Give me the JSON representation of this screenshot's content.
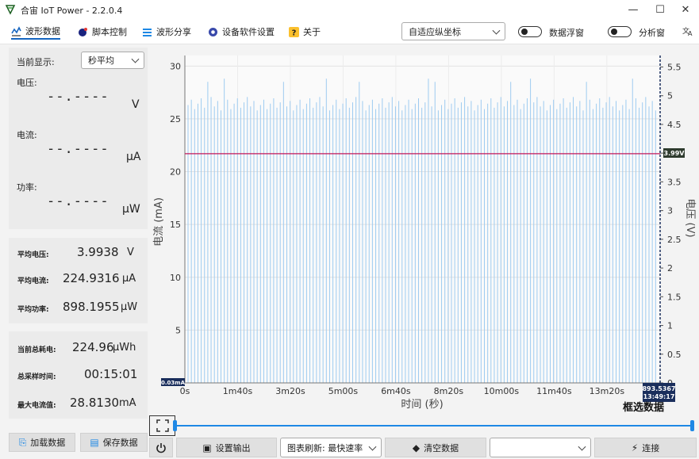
{
  "window": {
    "title": "合宙 IoT Power - 2.2.0.4"
  },
  "tabs": [
    {
      "label": "波形数据",
      "icon": "waveform-icon"
    },
    {
      "label": "脚本控制",
      "icon": "script-icon"
    },
    {
      "label": "波形分享",
      "icon": "share-icon"
    },
    {
      "label": "设备软件设置",
      "icon": "settings-icon"
    },
    {
      "label": "关于",
      "icon": "help-icon"
    }
  ],
  "toolbar": {
    "axis_mode": "自适应纵坐标",
    "float_window_label": "数据浮窗",
    "analysis_window_label": "分析窗"
  },
  "left": {
    "display_label": "当前显示:",
    "display_mode": "秒平均",
    "voltage": {
      "label": "电压:",
      "value": "--.----",
      "unit": "V"
    },
    "current": {
      "label": "电流:",
      "value": "--.----",
      "unit": "μA"
    },
    "power": {
      "label": "功率:",
      "value": "--.----",
      "unit": "μW"
    },
    "avg_voltage": {
      "label": "平均电压:",
      "value": "3.9938",
      "unit": "V"
    },
    "avg_current": {
      "label": "平均电流:",
      "value": "224.9316",
      "unit": "μA"
    },
    "avg_power": {
      "label": "平均功率:",
      "value": "898.1955",
      "unit": "μW"
    },
    "total_energy": {
      "label": "当前总耗电:",
      "value": "224.96",
      "unit": "μWh"
    },
    "sample_time": {
      "label": "总采样时间:",
      "value": "00:15:01"
    },
    "max_current": {
      "label": "最大电流值:",
      "value": "28.8130",
      "unit": "mA"
    },
    "load_button": "加载数据",
    "save_button": "保存数据"
  },
  "chart": {
    "ylabel_left": "电流 (mA)",
    "ylabel_right": "电压 (V)",
    "xlabel": "时间 (秒)",
    "left_ticks": [
      "30",
      "25",
      "20",
      "15",
      "10",
      "5",
      "0"
    ],
    "right_ticks": [
      "5.5",
      "5",
      "4.5",
      "4",
      "3.5",
      "3",
      "2.5",
      "2",
      "1.5",
      "1",
      "0.5",
      "0"
    ],
    "x_ticks": [
      "0s",
      "1m40s",
      "3m20s",
      "5m00s",
      "6m40s",
      "8m20s",
      "10m00s",
      "11m40s",
      "13m20s"
    ],
    "min_label": "0.03mA",
    "voltage_label": "3.99V",
    "cursor_value": "893.5367",
    "cursor_time": "13:49:17",
    "overlay_text": "框选数据"
  },
  "chart_data": {
    "type": "line",
    "xlabel": "时间 (秒)",
    "ylabel": "电流 (mA)",
    "y2label": "电压 (V)",
    "xlim_seconds": [
      0,
      901
    ],
    "ylim": [
      0,
      31
    ],
    "y2lim": [
      0,
      5.7
    ],
    "series": [
      {
        "name": "电流",
        "axis": "left",
        "color": "#9ecbf0",
        "description_values": {
          "baseline_mA": 0.03,
          "typical_peak_mA": 26.5,
          "max_peak_mA": 28.8
        }
      },
      {
        "name": "电压",
        "axis": "right",
        "color": "#d63384",
        "values_V": 3.99
      }
    ]
  },
  "bottom": {
    "settings_output": "设置输出",
    "refresh_label": "图表刷新: 最快速率",
    "clear_button": "清空数据",
    "port_value": "",
    "connect_button": "连接"
  }
}
